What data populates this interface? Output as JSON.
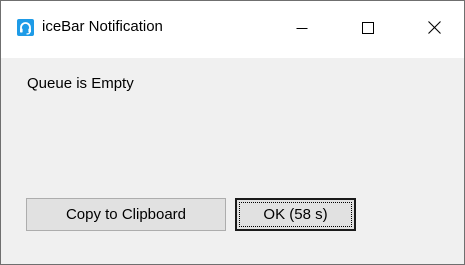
{
  "window": {
    "title": "iceBar Notification",
    "app_icon": "headset-icon",
    "controls": {
      "minimize_icon": "minimize-icon",
      "maximize_icon": "maximize-icon",
      "close_icon": "close-icon"
    }
  },
  "content": {
    "message": "Queue is Empty"
  },
  "buttons": {
    "copy_label": "Copy to Clipboard",
    "ok_label": "OK (58 s)"
  },
  "colors": {
    "app_icon_accent": "#1e9be7",
    "dialog_background": "#f0f0f0",
    "titlebar_background": "#ffffff",
    "button_background": "#e1e1e1"
  }
}
